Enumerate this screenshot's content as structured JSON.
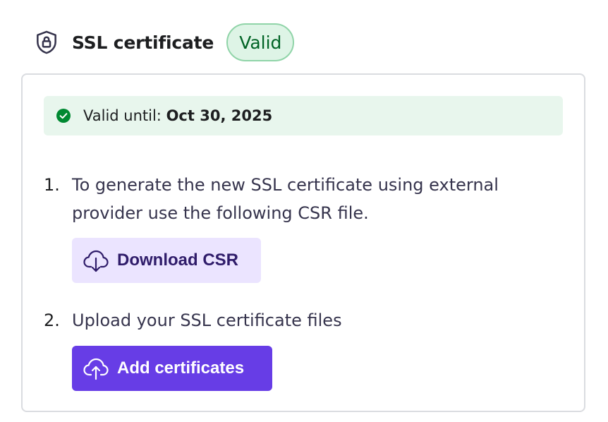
{
  "header": {
    "title": "SSL certificate",
    "status": "Valid",
    "icon": "shield-lock-icon"
  },
  "banner": {
    "label": "Valid until:",
    "date": "Oct 30, 2025",
    "icon": "check-circle-icon"
  },
  "steps": [
    {
      "number": "1.",
      "text": "To generate the new SSL certificate using external provider use the following CSR file.",
      "button_label": "Download CSR",
      "button_icon": "cloud-download-icon"
    },
    {
      "number": "2.",
      "text": "Upload your SSL certificate files",
      "button_label": "Add certificates",
      "button_icon": "cloud-upload-icon"
    }
  ],
  "colors": {
    "primary": "#673de6",
    "secondary_bg": "#ebe4ff",
    "success": "#008932",
    "success_bg": "#e8f6ed",
    "badge_border": "#90d4a8"
  }
}
